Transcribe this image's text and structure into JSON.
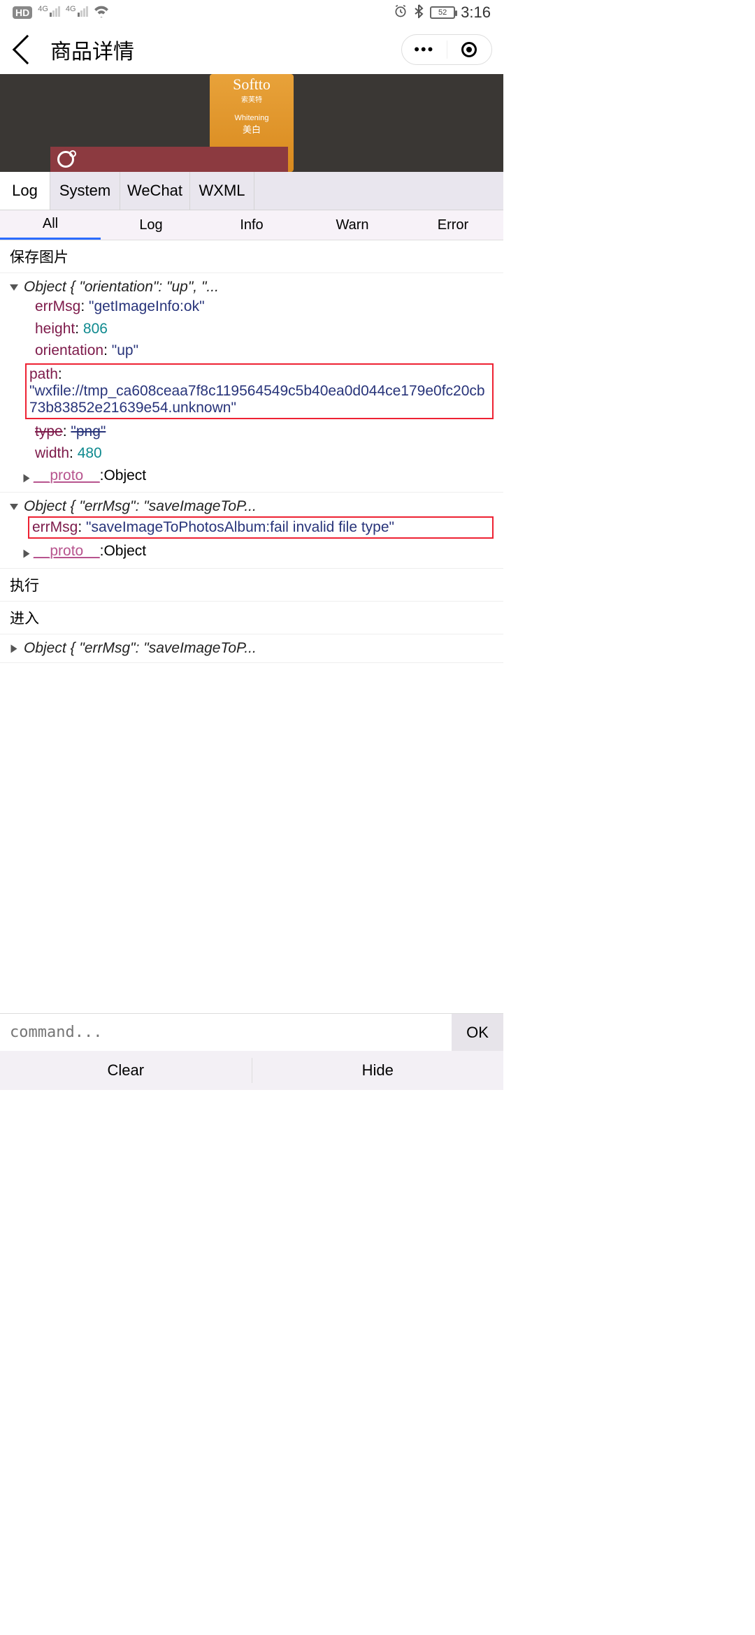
{
  "status": {
    "battery": "52",
    "time": "3:16",
    "net_label": "4G"
  },
  "nav": {
    "title": "商品详情"
  },
  "tabs1": [
    "Log",
    "System",
    "WeChat",
    "WXML"
  ],
  "tabs1_active": 0,
  "tabs2": [
    "All",
    "Log",
    "Info",
    "Warn",
    "Error"
  ],
  "tabs2_active": 0,
  "log": {
    "entry0": "保存图片",
    "obj1_summary": "Object { \"orientation\": \"up\", \"...",
    "obj1": {
      "errMsg_key": "errMsg",
      "errMsg_val": "\"getImageInfo:ok\"",
      "height_key": "height",
      "height_val": "806",
      "orientation_key": "orientation",
      "orientation_val": "\"up\"",
      "path_key": "path",
      "path_val": "\"wxfile://tmp_ca608ceaa7f8c119564549c5b40ea0d044ce179e0fc20cb73b83852e21639e54.unknown\"",
      "type_key": "type",
      "type_val": "\"png\"",
      "width_key": "width",
      "width_val": "480",
      "proto_key": "__proto__",
      "proto_val": "Object"
    },
    "obj2_summary": "Object { \"errMsg\": \"saveImageToP...",
    "obj2": {
      "errMsg_key": "errMsg",
      "errMsg_val": "\"saveImageToPhotosAlbum:fail invalid file type\"",
      "proto_key": "__proto__",
      "proto_val": "Object"
    },
    "entry3": "执行",
    "entry4": "进入",
    "obj3_summary": "Object { \"errMsg\": \"saveImageToP..."
  },
  "command_placeholder": "command...",
  "ok_label": "OK",
  "bottom": {
    "clear": "Clear",
    "hide": "Hide"
  },
  "product": {
    "brand": "Softto",
    "sub": "Whitening"
  }
}
